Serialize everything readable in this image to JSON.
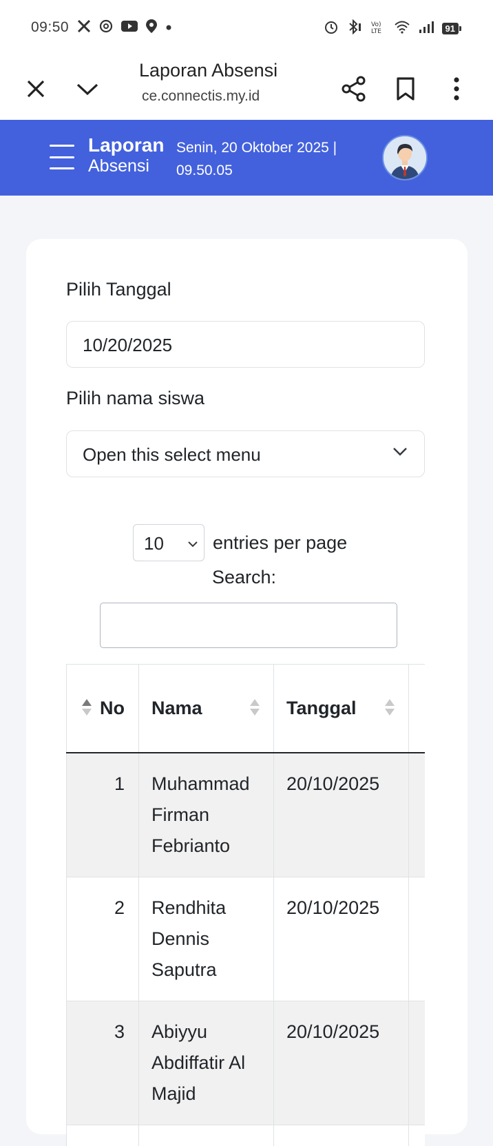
{
  "status_bar": {
    "time": "09:50",
    "battery": "91",
    "left_icons": [
      "x-icon",
      "threads-icon",
      "youtube-icon",
      "location-icon",
      "dot-icon"
    ],
    "right_icons": [
      "alarm-icon",
      "bluetooth-icon",
      "volte-icon",
      "wifi-icon",
      "signal-icon",
      "battery-icon"
    ]
  },
  "toolbar": {
    "title": "Laporan Absensi",
    "url": "ce.connectis.my.id"
  },
  "header": {
    "title_line1": "Laporan",
    "title_line2": "Absensi",
    "date_line1": "Senin, 20 Oktober 2025 |",
    "date_line2": "09.50.05",
    "accent": "#4361dd"
  },
  "form": {
    "date_label": "Pilih Tanggal",
    "date_value": "10/20/2025",
    "student_label": "Pilih nama siswa",
    "student_value": "Open this select menu"
  },
  "datatable": {
    "entries_value": "10",
    "entries_label": "entries per page",
    "search_label": "Search:",
    "search_value": "",
    "columns": [
      "No",
      "Nama",
      "Tanggal"
    ],
    "rows": [
      {
        "no": "1",
        "nama": "Muhammad Firman Febrianto",
        "tanggal": "20/10/2025"
      },
      {
        "no": "2",
        "nama": "Rendhita Dennis Saputra",
        "tanggal": "20/10/2025"
      },
      {
        "no": "3",
        "nama": "Abiyyu Abdiffatir Al Majid",
        "tanggal": "20/10/2025"
      },
      {
        "no": "",
        "nama": "",
        "tanggal": ""
      }
    ]
  }
}
